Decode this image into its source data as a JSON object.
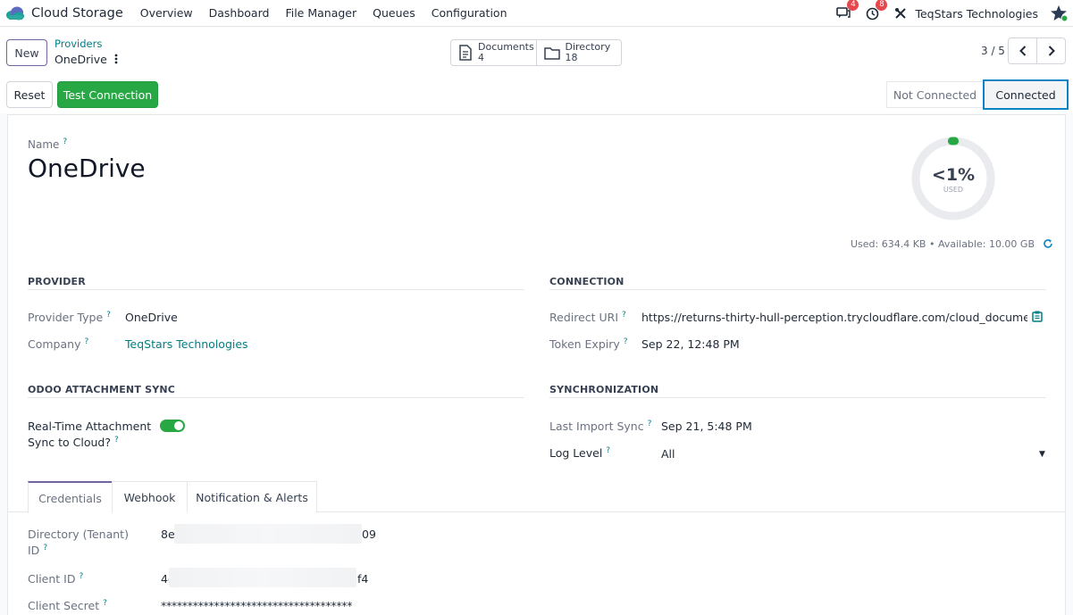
{
  "navbar": {
    "app_name": "Cloud Storage",
    "menu": [
      "Overview",
      "Dashboard",
      "File Manager",
      "Queues",
      "Configuration"
    ],
    "messages_count": "4",
    "activities_count": "8",
    "company": "TeqStars Technologies"
  },
  "control_panel": {
    "new_label": "New",
    "breadcrumb_parent": "Providers",
    "breadcrumb_current": "OneDrive",
    "stats": [
      {
        "label": "Documents",
        "value": "4"
      },
      {
        "label": "Directory",
        "value": "18"
      }
    ],
    "pager": "3 / 5",
    "reset_label": "Reset",
    "test_label": "Test Connection",
    "status": {
      "not_connected": "Not Connected",
      "connected": "Connected",
      "active": "connected"
    }
  },
  "form": {
    "name_label": "Name",
    "name_value": "OneDrive",
    "gauge": {
      "percent_text": "<1%",
      "used_label": "USED",
      "fraction": 0.001
    },
    "usage_text": "Used: 634.4 KB • Available: 10.00 GB",
    "provider_section": "PROVIDER",
    "provider_type_label": "Provider Type",
    "provider_type_value": "OneDrive",
    "company_label": "Company",
    "company_value": "TeqStars Technologies",
    "connection_section": "CONNECTION",
    "redirect_uri_label": "Redirect URI",
    "redirect_uri_value": "https://returns-thirty-hull-perception.trycloudflare.com/cloud_document/…",
    "token_expiry_label": "Token Expiry",
    "token_expiry_value": "Sep 22, 12:48 PM",
    "attachment_section": "ODOO ATTACHMENT SYNC",
    "realtime_label_1": "Real-Time Attachment",
    "realtime_label_2": "Sync to Cloud?",
    "realtime_enabled": true,
    "sync_section": "SYNCHRONIZATION",
    "last_import_label": "Last Import Sync",
    "last_import_value": "Sep 21, 5:48 PM",
    "log_level_label": "Log Level",
    "log_level_value": "All"
  },
  "tabs": [
    "Credentials",
    "Webhook",
    "Notification & Alerts"
  ],
  "credentials": {
    "tenant_label_1": "Directory (Tenant)",
    "tenant_label_2": "ID",
    "tenant_start": "8el",
    "tenant_end": "09",
    "client_id_label": "Client ID",
    "client_id_start": "4c",
    "client_id_end": "f4",
    "client_secret_label": "Client Secret",
    "client_secret_value": "************************************"
  },
  "colors": {
    "accent": "#017e84",
    "primary": "#71639e",
    "success": "#28a745",
    "danger": "#e5484d"
  }
}
